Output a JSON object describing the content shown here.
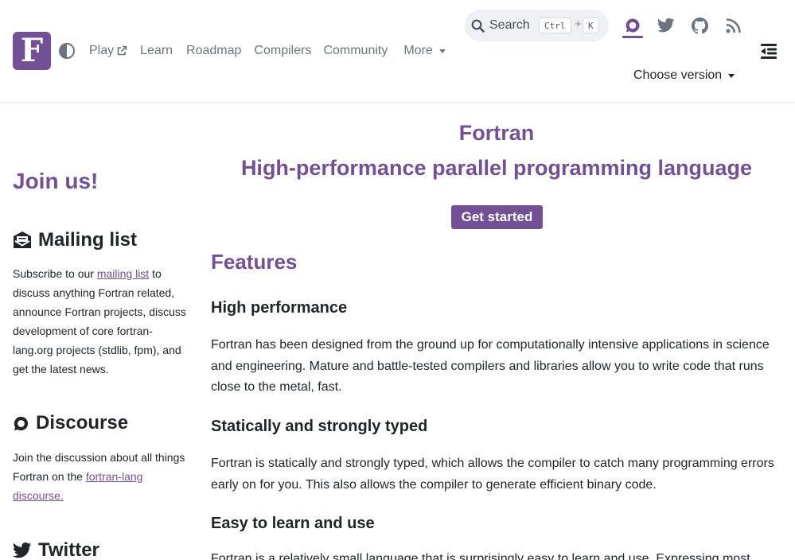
{
  "header": {
    "logo_letter": "F",
    "nav": {
      "play": "Play",
      "learn": "Learn",
      "roadmap": "Roadmap",
      "compilers": "Compilers",
      "community": "Community",
      "more": "More"
    },
    "search": {
      "label": "Search",
      "key1": "Ctrl",
      "plus": "+",
      "key2": "K"
    },
    "icons": [
      "theme-contrast-icon",
      "external-link-icon",
      "search-icon",
      "discourse-icon",
      "twitter-icon",
      "github-icon",
      "rss-icon",
      "sidebar-collapse-icon"
    ],
    "version_label": "Choose version"
  },
  "sidebar": {
    "join_title": "Join us!",
    "mailing": {
      "heading": "Mailing list",
      "text_before": "Subscribe to our ",
      "link": "mailing list",
      "text_after": " to discuss anything Fortran related, announce Fortran projects, discuss development of core fortran-lang.org projects (stdlib, fpm), and get the latest news."
    },
    "discourse": {
      "heading": "Discourse",
      "text_before": "Join the discussion about all things Fortran on the ",
      "link": "fortran-lang discourse."
    },
    "twitter": {
      "heading": "Twitter"
    }
  },
  "main": {
    "title": "Fortran",
    "subtitle": "High-performance parallel programming language",
    "cta": "Get started",
    "features_title": "Features",
    "features": [
      {
        "heading": "High performance",
        "text": "Fortran has been designed from the ground up for computationally intensive applications in science and engineering. Mature and battle-tested compilers and libraries allow you to write code that runs close to the metal, fast."
      },
      {
        "heading": "Statically and strongly typed",
        "text": "Fortran is statically and strongly typed, which allows the compiler to catch many programming errors early on for you. This also allows the compiler to generate efficient binary code."
      },
      {
        "heading": "Easy to learn and use",
        "text": "Fortran is a relatively small language that is surprisingly easy to learn and use. Expressing most"
      }
    ]
  },
  "colors": {
    "brand": "#734f96",
    "text": "#212529",
    "muted": "#6c757d",
    "search_bg": "#eef0f3"
  }
}
